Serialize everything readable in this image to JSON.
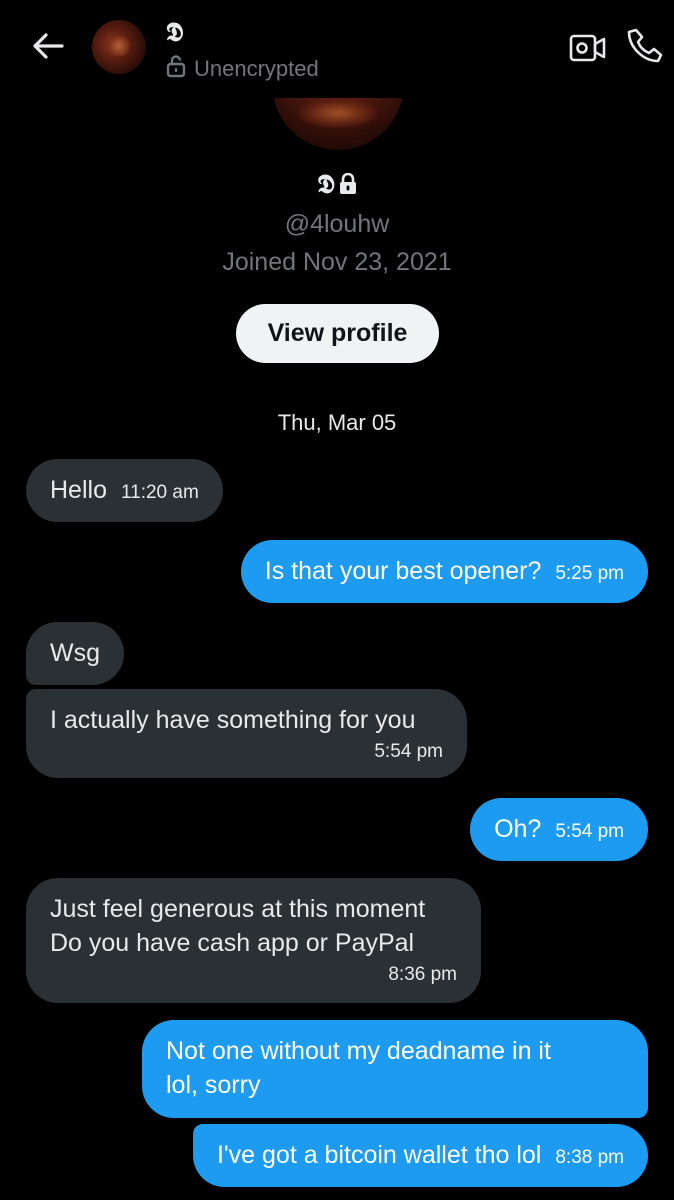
{
  "header": {
    "name": "𝕯",
    "status": "Unencrypted",
    "icons": {
      "back": "arrow-left-icon",
      "lock": "lock-open-icon",
      "video": "video-camera-icon",
      "call": "phone-icon"
    }
  },
  "profile": {
    "name": "𝕯",
    "handle": "@4louhw",
    "joined": "Joined Nov 23, 2021",
    "view_profile_label": "View profile"
  },
  "date_separator": "Thu, Mar 05",
  "messages": [
    {
      "direction": "incoming",
      "text": "Hello",
      "time": "11:20 am"
    },
    {
      "direction": "outgoing",
      "text": "Is that your best opener?",
      "time": "5:25 pm"
    },
    {
      "direction": "incoming",
      "text": "Wsg",
      "time": ""
    },
    {
      "direction": "incoming",
      "text": "I actually have something for you",
      "time": "5:54 pm"
    },
    {
      "direction": "outgoing",
      "text": "Oh?",
      "time": "5:54 pm"
    },
    {
      "direction": "incoming",
      "lines": [
        "Just feel generous at this moment",
        "Do you have cash app or PayPal"
      ],
      "time": "8:36 pm"
    },
    {
      "direction": "outgoing",
      "lines": [
        "Not one without my deadname in it",
        "lol, sorry"
      ],
      "time": ""
    },
    {
      "direction": "outgoing",
      "text": "I've got a bitcoin wallet tho lol",
      "time": "8:38 pm"
    }
  ],
  "colors": {
    "background": "#000000",
    "incoming_bubble": "#2b3035",
    "outgoing_bubble": "#1d9bf0",
    "muted_text": "#71767b"
  }
}
